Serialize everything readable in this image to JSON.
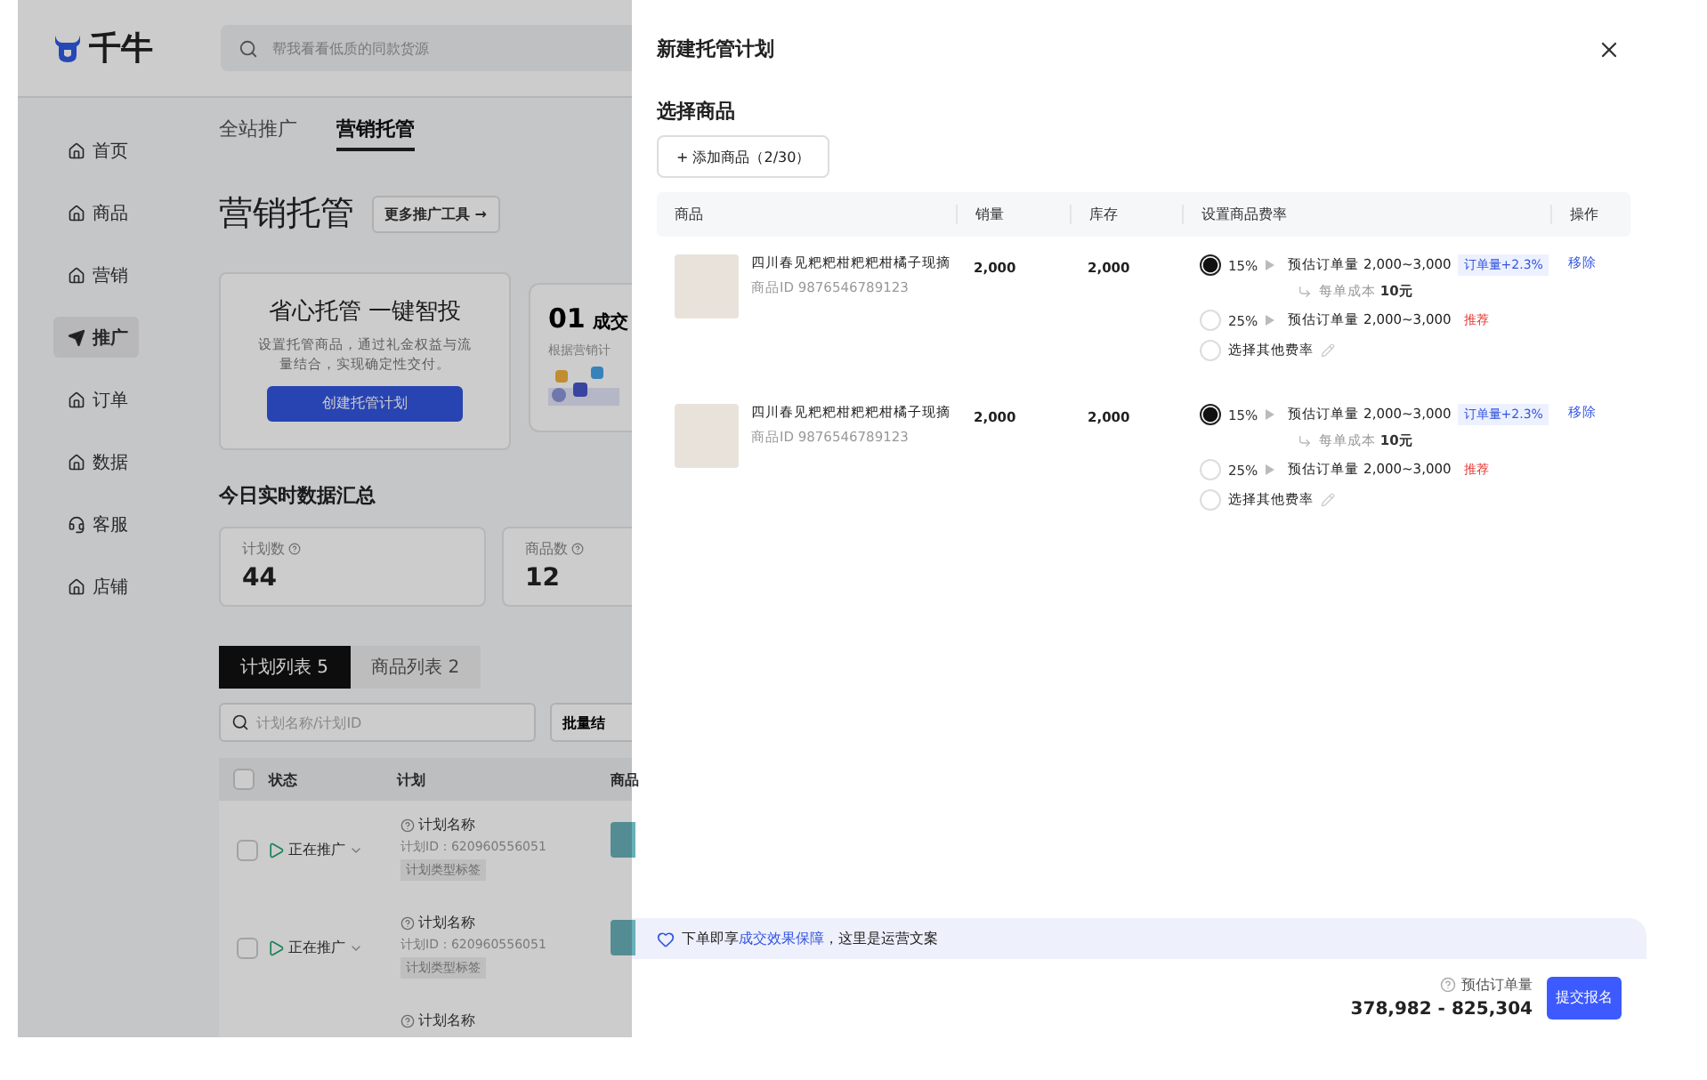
{
  "app": {
    "logo_text": "千牛",
    "search": {
      "placeholder": "帮我看看低质的同款货源"
    }
  },
  "sidebar": {
    "items": [
      {
        "label": "首页",
        "kind": "home",
        "selected": false
      },
      {
        "label": "商品",
        "kind": "home",
        "selected": false
      },
      {
        "label": "营销",
        "kind": "home",
        "selected": false
      },
      {
        "label": "推广",
        "kind": "send",
        "selected": true
      },
      {
        "label": "订单",
        "kind": "home",
        "selected": false
      },
      {
        "label": "数据",
        "kind": "home",
        "selected": false
      },
      {
        "label": "客服",
        "kind": "service",
        "selected": false
      },
      {
        "label": "店铺",
        "kind": "home",
        "selected": false
      }
    ]
  },
  "page": {
    "tabs": [
      {
        "label": "全站推广",
        "selected": false
      },
      {
        "label": "营销托管",
        "selected": true
      }
    ],
    "title": "营销托管",
    "tools_button": "更多推广工具 →",
    "promo_card": {
      "title": "省心托管 一键智投",
      "description": "设置托管商品，通过礼金权益与流量结合，实现确定性交付。",
      "button": "创建托管计划"
    },
    "step_card": {
      "number": "01",
      "title": "成交",
      "description": "根据营销计"
    },
    "summary_title": "今日实时数据汇总",
    "stats": [
      {
        "label": "计划数",
        "value": "44"
      },
      {
        "label": "商品数",
        "value": "12"
      }
    ],
    "list_tabs": [
      {
        "label": "计划列表 5",
        "selected": true
      },
      {
        "label": "商品列表 2",
        "selected": false
      }
    ],
    "list_search": {
      "placeholder": "计划名称/计划ID"
    },
    "batch_button": "批量结",
    "table": {
      "header_checked": false,
      "columns": [
        "状态",
        "计划",
        "商品"
      ],
      "rows": [
        {
          "checked": false,
          "status": "正在推广",
          "plan_name": "计划名称",
          "plan_id": "计划ID：620960556051",
          "plan_tag": "计划类型标签"
        },
        {
          "checked": false,
          "status": "正在推广",
          "plan_name": "计划名称",
          "plan_id": "计划ID：620960556051",
          "plan_tag": "计划类型标签"
        },
        {
          "plan_name": "计划名称"
        }
      ]
    }
  },
  "drawer": {
    "title": "新建托管计划",
    "section_title": "选择商品",
    "add_button": "+ 添加商品（2/30）",
    "table": {
      "columns": [
        "商品",
        "销量",
        "库存",
        "设置商品费率",
        "操作"
      ],
      "rows": [
        {
          "name": "四川春见粑粑柑粑粑柑橘子现摘",
          "product_id": "商品ID 9876546789123",
          "sales": "2,000",
          "stock": "2,000",
          "action": "移除",
          "options": [
            {
              "kind": "rate",
              "selected": true,
              "rate": "15%",
              "estimate": "预估订单量 2,000~3,000",
              "tag": {
                "kind": "boost",
                "text": "订单量+2.3%"
              },
              "note": "每单成本 **10元**"
            },
            {
              "kind": "rate",
              "selected": false,
              "rate": "25%",
              "estimate": "预估订单量 2,000~3,000",
              "tag": {
                "kind": "recommend",
                "text": "推荐"
              }
            },
            {
              "kind": "custom",
              "selected": false,
              "label": "选择其他费率"
            }
          ]
        },
        {
          "name": "四川春见粑粑柑粑粑柑橘子现摘",
          "product_id": "商品ID 9876546789123",
          "sales": "2,000",
          "stock": "2,000",
          "action": "移除",
          "options": [
            {
              "kind": "rate",
              "selected": true,
              "rate": "15%",
              "estimate": "预估订单量 2,000~3,000",
              "tag": {
                "kind": "boost",
                "text": "订单量+2.3%"
              },
              "note": "每单成本 **10元**"
            },
            {
              "kind": "rate",
              "selected": false,
              "rate": "25%",
              "estimate": "预估订单量 2,000~3,000",
              "tag": {
                "kind": "recommend",
                "text": "推荐"
              }
            },
            {
              "kind": "custom",
              "selected": false,
              "label": "选择其他费率"
            }
          ]
        }
      ]
    },
    "notice": {
      "before": "下单即享",
      "link": "成交效果保障",
      "after": "，这里是运营文案"
    },
    "estimate_label": "预估订单量",
    "estimate_value": "378,982 - 825,304",
    "submit_button": "提交报名"
  }
}
